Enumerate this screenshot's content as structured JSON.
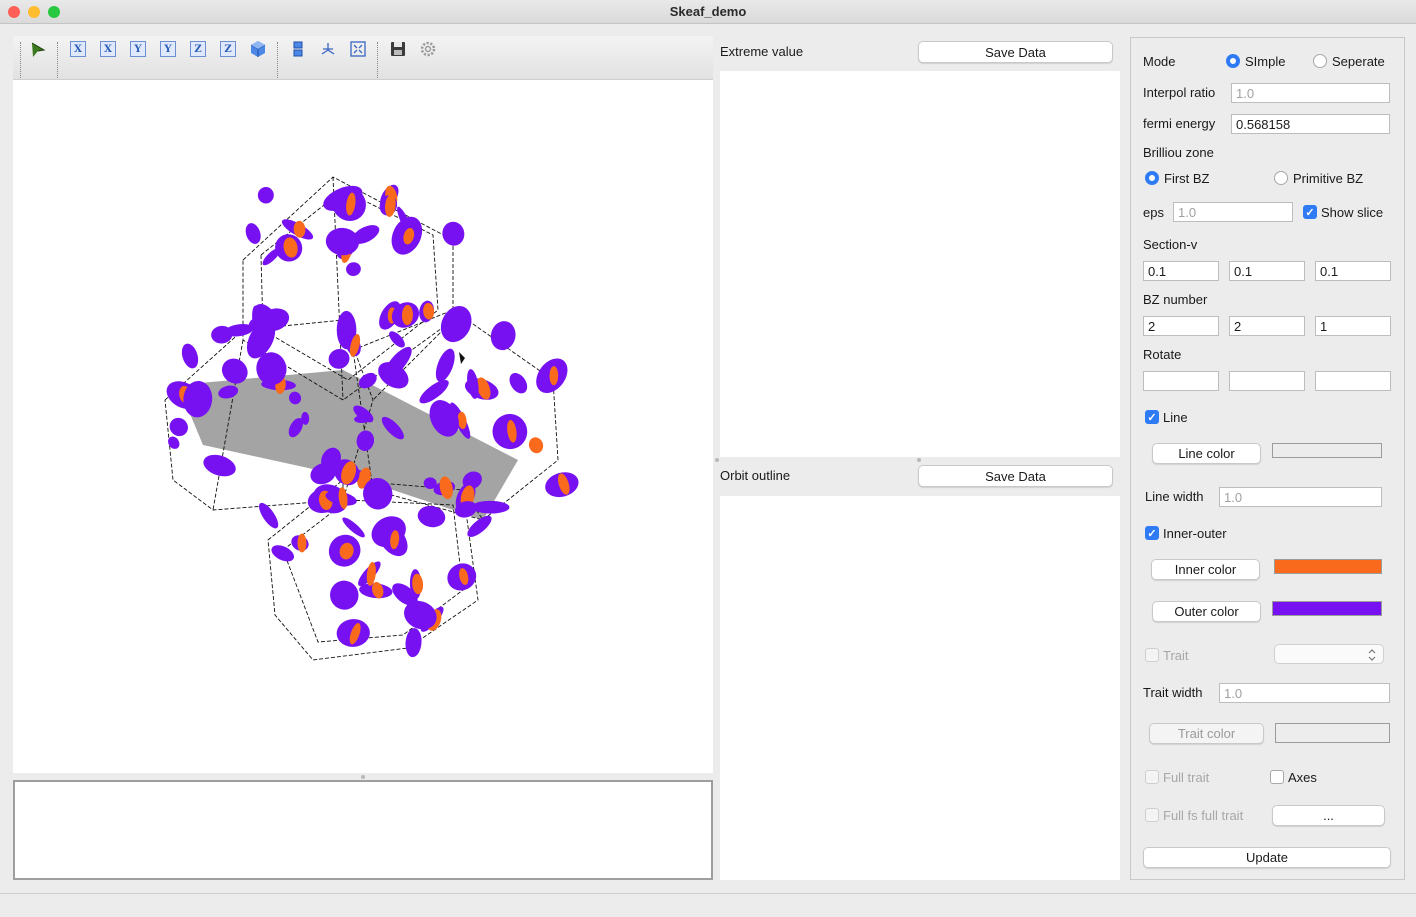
{
  "window": {
    "title": "Skeaf_demo",
    "traffic_lights": {
      "close": "#fe5f57",
      "minimize": "#febc2e",
      "zoom": "#28c840"
    }
  },
  "toolbar": {
    "icons": [
      "pointer-icon",
      "view-x-neg-icon",
      "view-x-pos-icon",
      "view-y-neg-icon",
      "view-y-pos-icon",
      "view-z-neg-icon",
      "view-z-pos-icon",
      "iso-cube-icon",
      "split-view-icon",
      "axes-icon",
      "fit-view-icon",
      "save-icon",
      "settings-icon"
    ],
    "x_label": "X",
    "y_label": "Y",
    "z_label": "Z"
  },
  "extreme": {
    "label": "Extreme value",
    "save_label": "Save Data"
  },
  "orbit": {
    "label": "Orbit outline",
    "save_label": "Save Data"
  },
  "controls": {
    "mode_label": "Mode",
    "mode_simple": "SImple",
    "mode_seperate": "Seperate",
    "interpol_label": "Interpol  ratio",
    "interpol_placeholder": "1.0",
    "fermi_label": "fermi energy",
    "fermi_value": "0.568158",
    "bz_label": "Brilliou zone",
    "first_bz": "First BZ",
    "primitive_bz": "Primitive BZ",
    "eps_label": "eps",
    "eps_placeholder": "1.0",
    "show_slice": "Show slice",
    "section_label": "Section-v",
    "section_values": [
      "0.1",
      "0.1",
      "0.1"
    ],
    "bz_number_label": "BZ number",
    "bz_number_values": [
      "2",
      "2",
      "1"
    ],
    "rotate_label": "Rotate",
    "rotate_values": [
      "",
      "",
      ""
    ],
    "line_label": "Line",
    "line_color_button": "Line color",
    "line_width_label": "Line width",
    "line_width_placeholder": "1.0",
    "inner_outer_label": "Inner-outer",
    "inner_color_button": "Inner color",
    "outer_color_button": "Outer color",
    "trait_label": "Trait",
    "trait_width_label": "Trait width",
    "trait_width_placeholder": "1.0",
    "trait_color_button": "Trait color",
    "full_trait_label": "Full trait",
    "axes_label": "Axes",
    "full_fs_label": "Full fs full trait",
    "more_button": "...",
    "update_button": "Update"
  },
  "colors": {
    "inner": "#fa6a1c",
    "outer": "#7711f2",
    "slice": "#9a9a9a",
    "line_swatch": "#ececec",
    "accent": "#2f7bf5"
  }
}
